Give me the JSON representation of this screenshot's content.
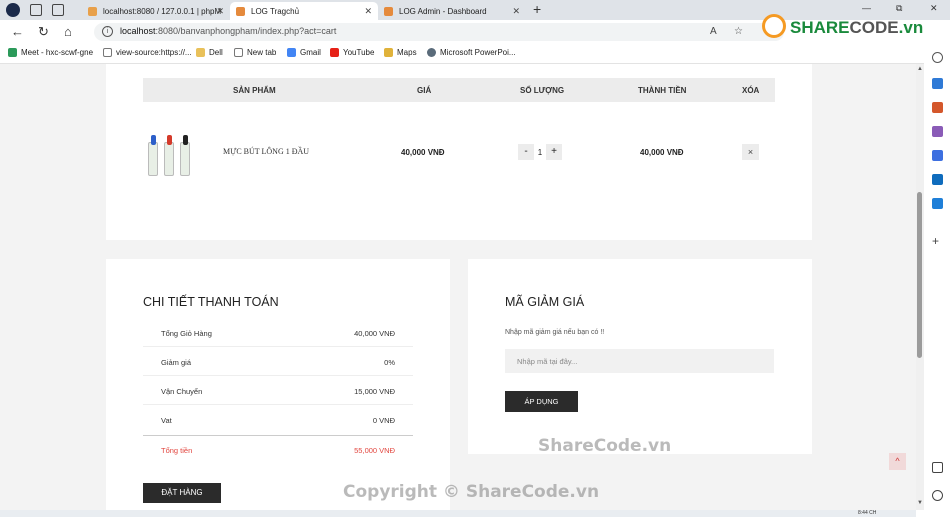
{
  "tabs": [
    {
      "title": "localhost:8080 / 127.0.0.1 | phpM",
      "fav_color": "#e8a04a"
    },
    {
      "title": "LOG Tragchủ",
      "fav_color": "#e58a3c"
    },
    {
      "title": "LOG Admin - Dashboard",
      "fav_color": "#e58a3c"
    }
  ],
  "new_tab_symbol": "+",
  "window_controls": [
    "—",
    "⧉",
    "✕"
  ],
  "url": {
    "host": "localhost",
    "rest": ":8080/banvanphongpham/index.php?act=cart"
  },
  "bookmarks": [
    "Meet - hxc-scwf-gne",
    "view-source:https://...",
    "Dell",
    "New tab",
    "Gmail",
    "YouTube",
    "Maps",
    "Microsoft PowerPoi..."
  ],
  "logo": {
    "brand_a": "SHARE",
    "brand_b": "CODE",
    "brand_c": ".vn"
  },
  "cart": {
    "headers": {
      "product": "SẢN PHẨM",
      "price": "GIÁ",
      "qty": "SỐ LƯỢNG",
      "total": "THÀNH TIỀN",
      "delete": "XÓA"
    },
    "items": [
      {
        "name": "MỰC BÚT LÔNG 1 ĐẦU",
        "price": "40,000 VNĐ",
        "qty_minus": "-",
        "qty": "1",
        "qty_plus": "+",
        "total": "40,000 VNĐ",
        "delete": "×"
      }
    ]
  },
  "payment": {
    "title": "CHI TIẾT THANH TOÁN",
    "rows": [
      {
        "label": "Tổng Giỏ Hàng",
        "value": "40,000 VNĐ"
      },
      {
        "label": "Giảm giá",
        "value": "0%"
      },
      {
        "label": "Vận Chuyển",
        "value": "15,000 VNĐ"
      },
      {
        "label": "Vat",
        "value": "0 VNĐ"
      }
    ],
    "total": {
      "label": "Tổng tiền",
      "value": "55,000 VNĐ"
    },
    "order_button": "ĐẶT HÀNG"
  },
  "coupon": {
    "title": "MÃ GIẢM GIÁ",
    "hint": "Nhập mã giảm giá nếu bạn có !!",
    "placeholder": "Nhập mã tại đây...",
    "apply_button": "ÁP DỤNG"
  },
  "to_top": "^",
  "watermarks": {
    "mid": "ShareCode.vn",
    "bottom": "Copyright © ShareCode.vn"
  },
  "taskbar_time": "8:44 CH",
  "colors": {
    "accent_dark": "#2b2b2b",
    "total_red": "#e2463f",
    "brand_green": "#1a8a3c",
    "brand_orange": "#f59a23"
  }
}
